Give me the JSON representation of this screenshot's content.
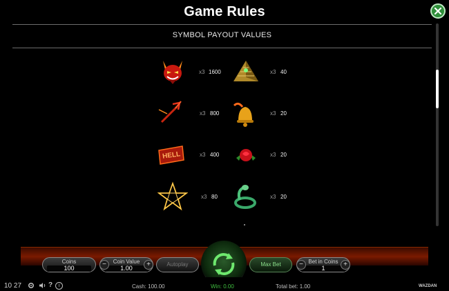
{
  "rules": {
    "title": "Game Rules",
    "section_title": "SYMBOL PAYOUT VALUES",
    "close_icon": "close-x-icon",
    "symbols": [
      {
        "icon": "devil-face-icon",
        "multiplier": "x3",
        "payout": "1600"
      },
      {
        "icon": "pyramid-icon",
        "multiplier": "x3",
        "payout": "40"
      },
      {
        "icon": "trident-icon",
        "multiplier": "x3",
        "payout": "800"
      },
      {
        "icon": "bell-icon",
        "multiplier": "x3",
        "payout": "20"
      },
      {
        "icon": "hell-sign-icon",
        "sign_text": "HELL",
        "multiplier": "x3",
        "payout": "400"
      },
      {
        "icon": "rose-icon",
        "multiplier": "x3",
        "payout": "20"
      },
      {
        "icon": "pentagram-icon",
        "multiplier": "x3",
        "payout": "80"
      },
      {
        "icon": "snake-icon",
        "multiplier": "x3",
        "payout": "20"
      }
    ]
  },
  "controls": {
    "coins": {
      "label": "Coins",
      "value": "100"
    },
    "coin_value": {
      "label": "Coin Value",
      "value": "1.00"
    },
    "autoplay_label": "Autoplay",
    "max_bet_label": "Max Bet",
    "bet_in_coins": {
      "label": "Bet in Coins",
      "value": "1"
    },
    "minus": "−",
    "plus": "+"
  },
  "footer": {
    "time": "10 27",
    "cash": "Cash: 100.00",
    "win": "Win: 0.00",
    "total_bet": "Total bet: 1.00",
    "brand": "WAZDAN",
    "help_glyph": "?",
    "info_glyph": "i"
  },
  "colors": {
    "accent_green": "#2f8f3a",
    "win_green": "#3fbf3f"
  }
}
